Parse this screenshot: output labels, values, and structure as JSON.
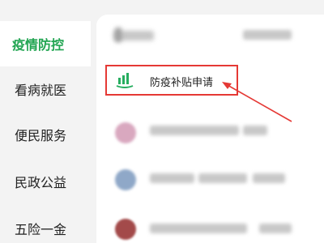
{
  "sidebar": {
    "items": [
      {
        "label": "疫情防控"
      },
      {
        "label": "看病就医"
      },
      {
        "label": "便民服务"
      },
      {
        "label": "民政公益"
      },
      {
        "label": "五险一金"
      }
    ]
  },
  "main": {
    "highlighted_service": {
      "label": "防疫补贴申请",
      "icon": "building-growth-icon"
    }
  },
  "colors": {
    "accent": "#22a552",
    "highlight": "#e53935"
  }
}
